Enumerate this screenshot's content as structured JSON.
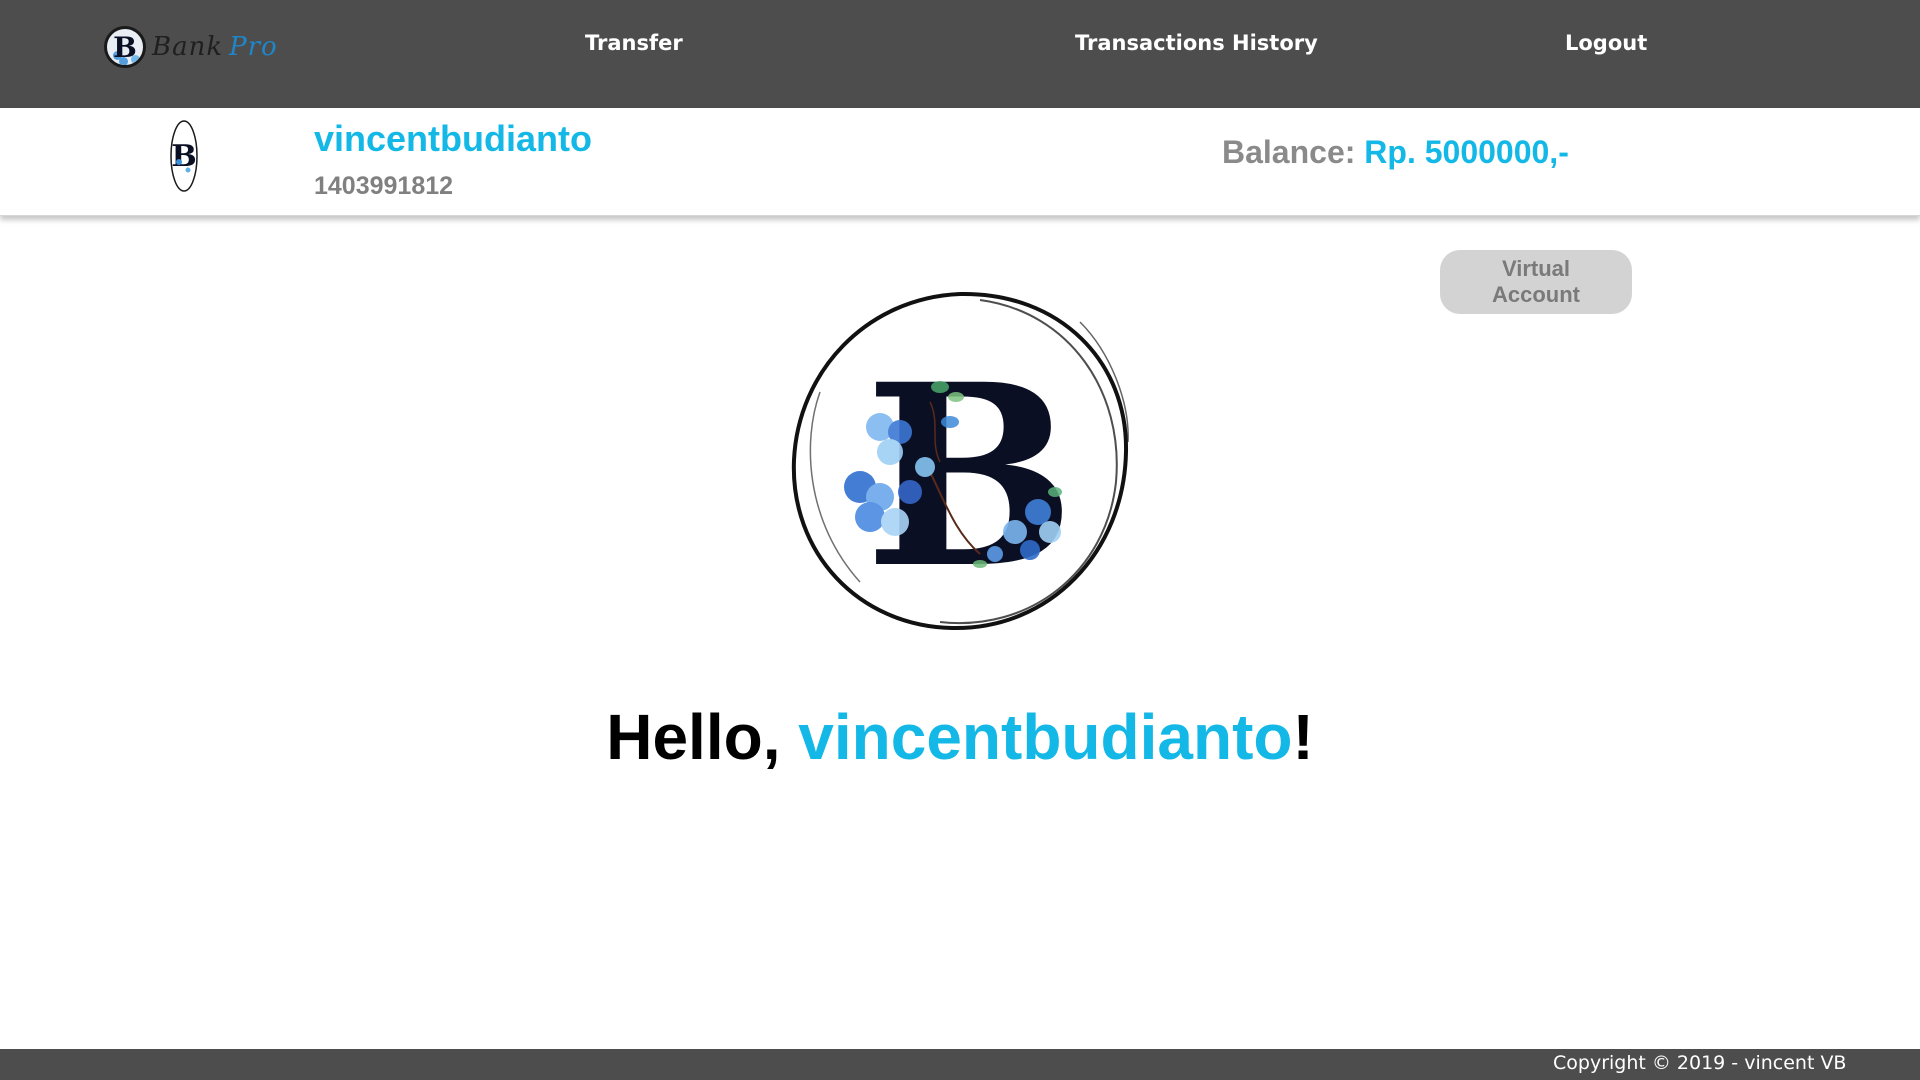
{
  "nav": {
    "brand_word_1": "Bank",
    "brand_word_2": "Pro",
    "links": [
      "Transfer",
      "Transactions History",
      "Logout"
    ]
  },
  "account": {
    "username": "vincentbudianto",
    "account_number": "1403991812",
    "balance_label": "Balance: ",
    "balance_value": "Rp. 5000000,-"
  },
  "main": {
    "virtual_account_button": "Virtual Account",
    "greeting_prefix": "Hello, ",
    "greeting_name": "vincentbudianto",
    "greeting_suffix": "!",
    "logo_letter": "B"
  },
  "footer": {
    "copyright": "Copyright © 2019 - vincent VB"
  },
  "colors": {
    "nav_bg": "#4d4d4d",
    "accent": "#13b8e6",
    "muted_text": "#808080",
    "button_bg": "#d3d3d3"
  }
}
